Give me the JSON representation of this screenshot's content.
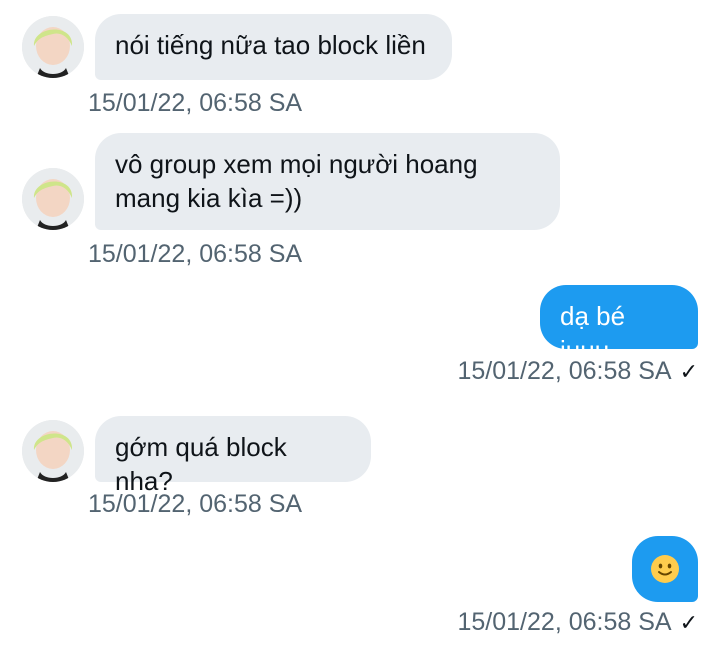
{
  "messages": [
    {
      "direction": "in",
      "text": "nói tiếng nữa tao block liền",
      "time": "15/01/22, 06:58 SA"
    },
    {
      "direction": "in",
      "text": "vô group xem mọi người hoang mang kia kìa =))",
      "time": "15/01/22, 06:58 SA"
    },
    {
      "direction": "out",
      "text": "dạ bé iuuu",
      "time": "15/01/22, 06:58 SA",
      "status_icon": "check-icon"
    },
    {
      "direction": "in",
      "text": "gớm quá block nha?",
      "time": "15/01/22, 06:58 SA"
    },
    {
      "direction": "out",
      "emoji": "slightly-smiling-face-icon",
      "time": "15/01/22, 06:58 SA",
      "status_icon": "check-icon"
    }
  ],
  "colors": {
    "incoming_bubble": "#e8ecf0",
    "outgoing_bubble": "#1d9bf0",
    "timestamp": "#536471"
  },
  "check_glyph": "✓"
}
